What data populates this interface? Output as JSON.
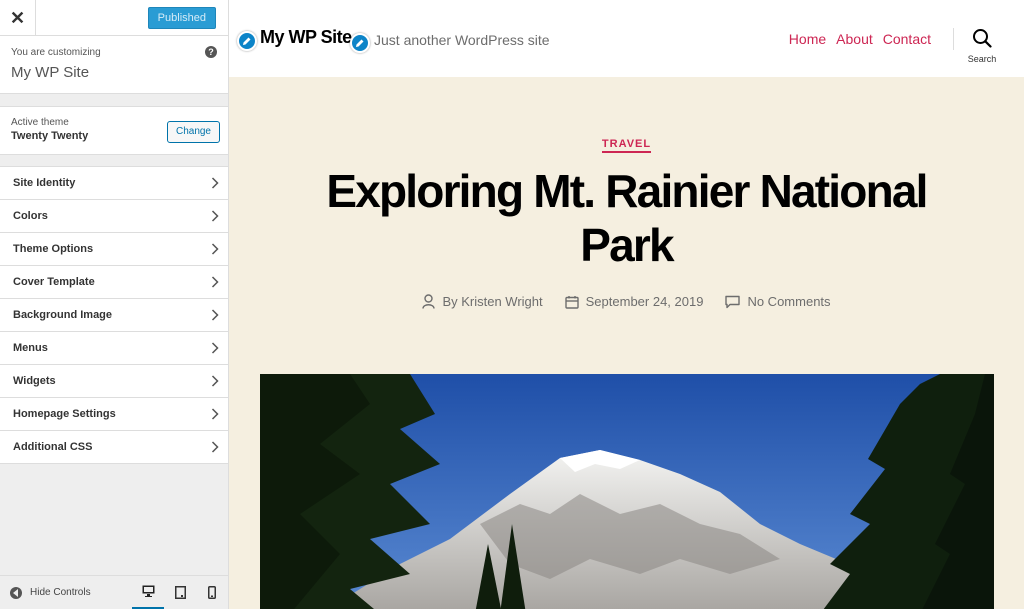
{
  "customizer": {
    "close_glyph": "✕",
    "publish_label": "Published",
    "customizing_label": "You are customizing",
    "site_name": "My WP Site",
    "help_glyph": "?",
    "active_theme_label": "Active theme",
    "active_theme_name": "Twenty Twenty",
    "change_label": "Change",
    "menu": [
      {
        "label": "Site Identity"
      },
      {
        "label": "Colors"
      },
      {
        "label": "Theme Options"
      },
      {
        "label": "Cover Template"
      },
      {
        "label": "Background Image"
      },
      {
        "label": "Menus"
      },
      {
        "label": "Widgets"
      },
      {
        "label": "Homepage Settings"
      },
      {
        "label": "Additional CSS"
      }
    ],
    "hide_controls_label": "Hide Controls",
    "devices": [
      "desktop-icon",
      "tablet-icon",
      "mobile-icon"
    ],
    "accent_color": "#0073aa"
  },
  "preview": {
    "site_title": "My WP Site",
    "tagline": "Just another WordPress site",
    "nav": [
      {
        "label": "Home"
      },
      {
        "label": "About"
      },
      {
        "label": "Contact"
      }
    ],
    "search_label": "Search",
    "category": "TRAVEL",
    "post_title": "Exploring Mt. Rainier National Park",
    "author": "By Kristen Wright",
    "date": "September 24, 2019",
    "comments": "No Comments",
    "accent_color": "#cd2653",
    "background_color": "#f5efe0"
  }
}
